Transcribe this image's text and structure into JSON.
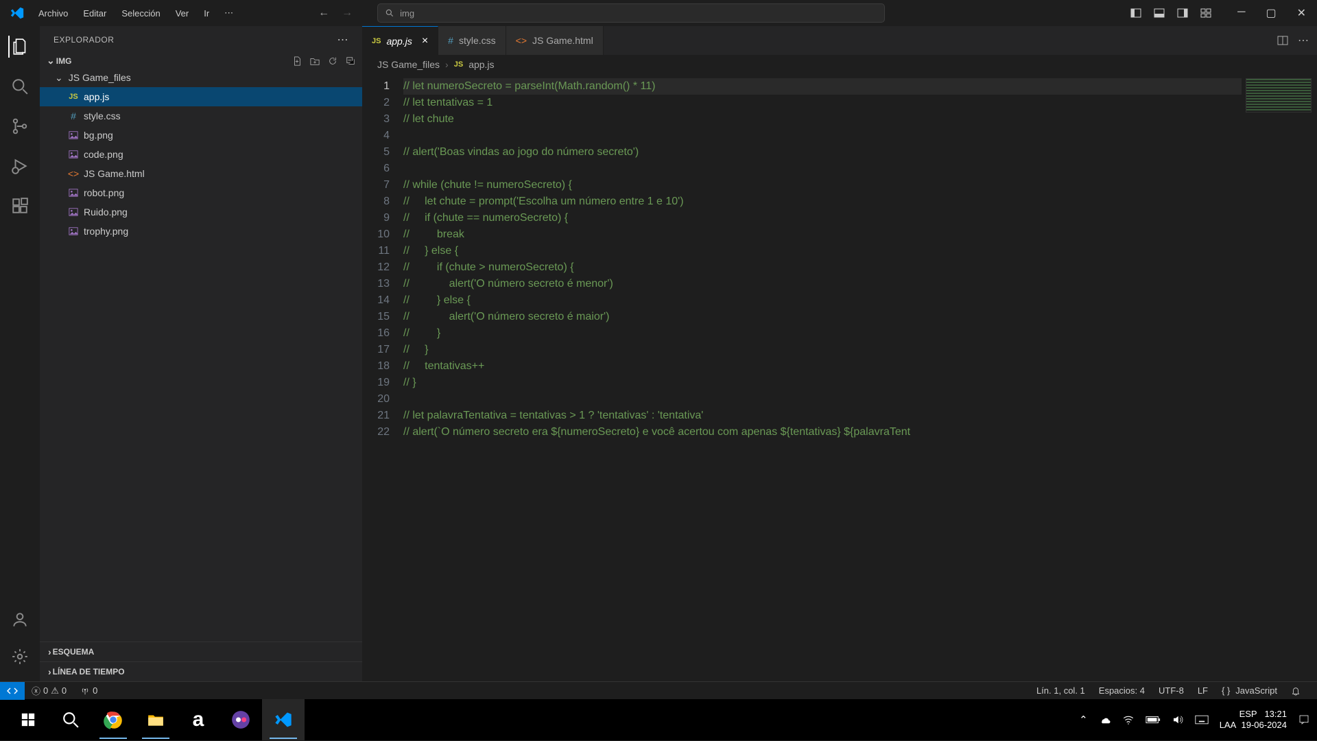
{
  "menu": [
    "Archivo",
    "Editar",
    "Selección",
    "Ver",
    "Ir"
  ],
  "search_text": "img",
  "explorer_title": "EXPLORADOR",
  "root_folder": "IMG",
  "subfolder": "JS Game_files",
  "files": [
    {
      "name": "app.js",
      "type": "js",
      "selected": true
    },
    {
      "name": "style.css",
      "type": "css"
    },
    {
      "name": "bg.png",
      "type": "img"
    },
    {
      "name": "code.png",
      "type": "img"
    },
    {
      "name": "JS Game.html",
      "type": "html"
    },
    {
      "name": "robot.png",
      "type": "img"
    },
    {
      "name": "Ruido.png",
      "type": "img"
    },
    {
      "name": "trophy.png",
      "type": "img"
    }
  ],
  "sidebar_panels": [
    "ESQUEMA",
    "LÍNEA DE TIEMPO"
  ],
  "tabs": [
    {
      "name": "app.js",
      "type": "js",
      "active": true
    },
    {
      "name": "style.css",
      "type": "css"
    },
    {
      "name": "JS Game.html",
      "type": "html"
    }
  ],
  "breadcrumbs": [
    "JS Game_files",
    "app.js"
  ],
  "code_lines": [
    "// let numeroSecreto = parseInt(Math.random() * 11)",
    "// let tentativas = 1",
    "// let chute",
    "",
    "// alert('Boas vindas ao jogo do número secreto')",
    "",
    "// while (chute != numeroSecreto) {",
    "//     let chute = prompt('Escolha um número entre 1 e 10')",
    "//     if (chute == numeroSecreto) {",
    "//         break",
    "//     } else {",
    "//         if (chute > numeroSecreto) {",
    "//             alert('O número secreto é menor')",
    "//         } else {",
    "//             alert('O número secreto é maior')",
    "//         }",
    "//     }",
    "//     tentativas++",
    "// }",
    "",
    "// let palavraTentativa = tentativas > 1 ? 'tentativas' : 'tentativa'",
    "// alert(`O número secreto era ${numeroSecreto} e você acertou com apenas ${tentativas} ${palavraTent"
  ],
  "statusbar": {
    "errors": "0",
    "warnings": "0",
    "ports": "0",
    "position": "Lín. 1, col. 1",
    "spaces": "Espacios: 4",
    "encoding": "UTF-8",
    "eol": "LF",
    "language": "JavaScript"
  },
  "systray": {
    "lang1": "ESP",
    "lang2": "LAA",
    "time": "13:21",
    "date": "19-06-2024"
  }
}
